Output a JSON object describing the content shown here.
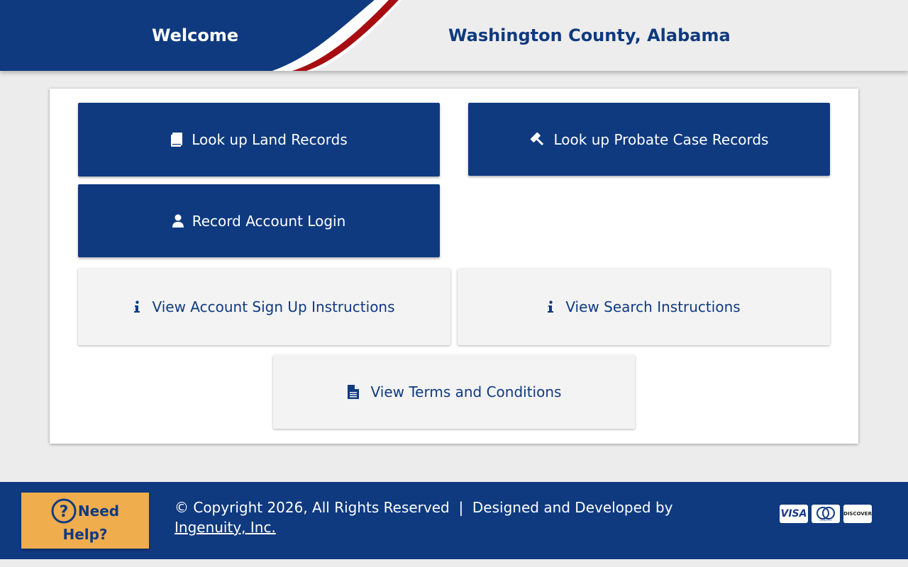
{
  "header": {
    "welcome": "Welcome",
    "county": "Washington County, Alabama"
  },
  "buttons": {
    "land_records": {
      "label": "Look up Land Records",
      "icon": "book-icon"
    },
    "probate_records": {
      "label": "Look up Probate Case Records",
      "icon": "gavel-icon"
    },
    "account_login": {
      "label": "Record Account Login",
      "icon": "user-icon"
    },
    "signup_instructions": {
      "label": "View Account Sign Up Instructions",
      "icon": "info-icon"
    },
    "search_instructions": {
      "label": "View Search Instructions",
      "icon": "info-icon"
    },
    "terms": {
      "label": "View Terms and Conditions",
      "icon": "document-icon"
    }
  },
  "footer": {
    "help_line1": "Need",
    "help_line2": "Help?",
    "copyright": "© Copyright 2026, All Rights Reserved  |  Designed and Developed by",
    "developer_link": "Ingenuity, Inc.",
    "payment_cards": [
      "VISA",
      "mastercard",
      "DISCOVER"
    ]
  },
  "colors": {
    "primary": "#0f3a80",
    "light_button": "#f3f3f3",
    "help_button": "#f0ad4e",
    "accent_red": "#a80d12"
  }
}
